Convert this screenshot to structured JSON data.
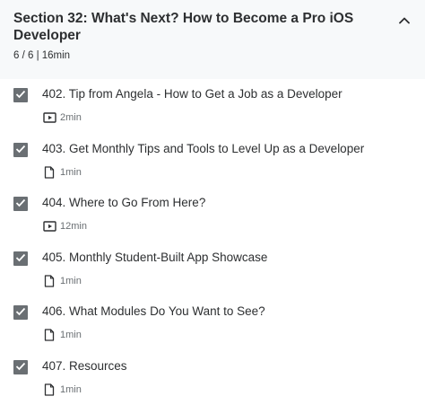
{
  "section": {
    "title": "Section 32: What's Next? How to Become a Pro iOS Developer",
    "progress": "6 / 6 | 16min",
    "collapse_icon": "chevron-up-icon"
  },
  "lectures": [
    {
      "title": "402. Tip from Angela - How to Get a Job as a Developer",
      "type": "video",
      "icon": "video-icon",
      "duration": "2min",
      "completed": true
    },
    {
      "title": "403. Get Monthly Tips and Tools to Level Up as a Developer",
      "type": "article",
      "icon": "file-icon",
      "duration": "1min",
      "completed": true
    },
    {
      "title": "404. Where to Go From Here?",
      "type": "video",
      "icon": "video-icon",
      "duration": "12min",
      "completed": true
    },
    {
      "title": "405. Monthly Student-Built App Showcase",
      "type": "article",
      "icon": "file-icon",
      "duration": "1min",
      "completed": true
    },
    {
      "title": "406. What Modules Do You Want to See?",
      "type": "article",
      "icon": "file-icon",
      "duration": "1min",
      "completed": true
    },
    {
      "title": "407. Resources",
      "type": "article",
      "icon": "file-icon",
      "duration": "1min",
      "completed": true
    }
  ],
  "colors": {
    "header_bg": "#f7f9fa",
    "checkbox_bg": "#6a6f73",
    "text": "#2d2f31",
    "muted": "#6a6f73"
  }
}
